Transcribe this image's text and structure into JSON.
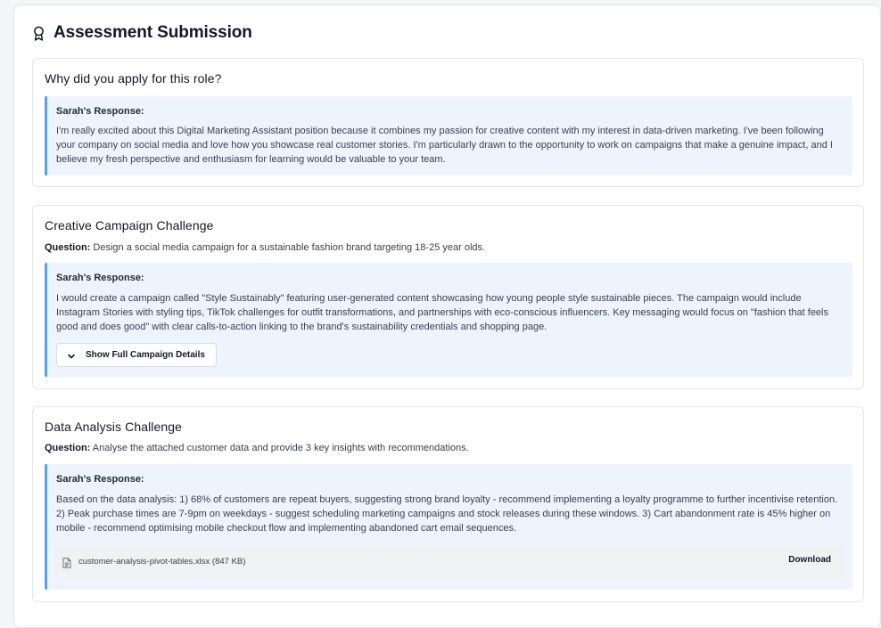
{
  "panel": {
    "title": "Assessment Submission",
    "icon": "award-icon"
  },
  "cards": [
    {
      "title": "Why did you apply for this role?",
      "response_label": "Sarah's Response:",
      "response_text": "I'm really excited about this Digital Marketing Assistant position because it combines my passion for creative content with my interest in data-driven marketing. I've been following your company on social media and love how you showcase real customer stories. I'm particularly drawn to the opportunity to work on campaigns that make a genuine impact, and I believe my fresh perspective and enthusiasm for learning would be valuable to your team."
    },
    {
      "title": "Creative Campaign Challenge",
      "question_label": "Question:",
      "question_text": "Design a social media campaign for a sustainable fashion brand targeting 18-25 year olds.",
      "response_label": "Sarah's Response:",
      "response_text": "I would create a campaign called \"Style Sustainably\" featuring user-generated content showcasing how young people style sustainable pieces. The campaign would include Instagram Stories with styling tips, TikTok challenges for outfit transformations, and partnerships with eco-conscious influencers. Key messaging would focus on \"fashion that feels good and does good\" with clear calls-to-action linking to the brand's sustainability credentials and shopping page.",
      "toggle_label": "Show Full Campaign Details",
      "toggle_icon": "chevron-down-icon"
    },
    {
      "title": "Data Analysis Challenge",
      "question_label": "Question:",
      "question_text": "Analyse the attached customer data and provide 3 key insights with recommendations.",
      "response_label": "Sarah's Response:",
      "response_text": "Based on the data analysis: 1) 68% of customers are repeat buyers, suggesting strong brand loyalty - recommend implementing a loyalty programme to further incentivise retention. 2) Peak purchase times are 7-9pm on weekdays - suggest scheduling marketing campaigns and stock releases during these windows. 3) Cart abandonment rate is 45% higher on mobile - recommend optimising mobile checkout flow and implementing abandoned cart email sequences.",
      "attachment": {
        "icon": "file-icon",
        "file_name": "customer-analysis-pivot-tables.xlsx (847 KB)",
        "download_label": "Download"
      }
    }
  ],
  "colors": {
    "accent_border": "#5a9ff0",
    "response_bg": "#eef4fe",
    "page_bg": "#f4f5f7"
  }
}
